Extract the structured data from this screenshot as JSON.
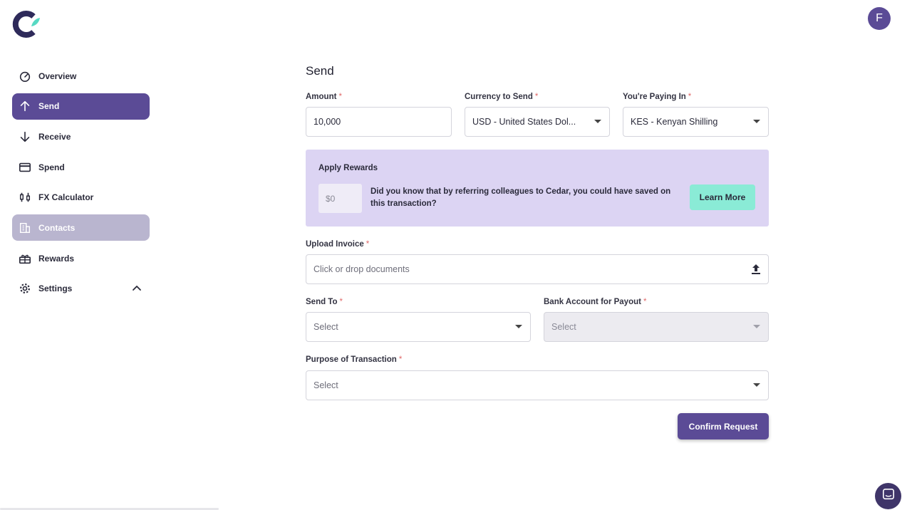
{
  "brand": {
    "avatar_letter": "F",
    "primary_color": "#5b4b96",
    "accent_color": "#57d9c3"
  },
  "nav": {
    "items": [
      {
        "label": "Overview",
        "icon": "gauge-icon"
      },
      {
        "label": "Send",
        "icon": "arrow-up-icon"
      },
      {
        "label": "Receive",
        "icon": "arrow-down-icon"
      },
      {
        "label": "Spend",
        "icon": "credit-card-icon"
      },
      {
        "label": "FX Calculator",
        "icon": "fx-calculator-icon"
      },
      {
        "label": "Contacts",
        "icon": "building-icon"
      },
      {
        "label": "Rewards",
        "icon": "gift-icon"
      },
      {
        "label": "Settings",
        "icon": "gear-icon"
      }
    ]
  },
  "page": {
    "title": "Send"
  },
  "form": {
    "amount": {
      "label": "Amount",
      "value": "10,000"
    },
    "currency_send": {
      "label": "Currency to Send",
      "value": "USD - United States Dol..."
    },
    "paying_in": {
      "label": "You're Paying In",
      "value": "KES - Kenyan Shilling"
    },
    "rewards": {
      "title": "Apply Rewards",
      "amount": "$0",
      "message": "Did you know that by referring colleagues to Cedar, you could have saved on this transaction?",
      "learn_more": "Learn More"
    },
    "upload_invoice": {
      "label": "Upload Invoice",
      "placeholder": "Click or drop documents"
    },
    "send_to": {
      "label": "Send To",
      "value": "Select"
    },
    "bank_account": {
      "label": "Bank Account for Payout",
      "value": "Select"
    },
    "purpose": {
      "label": "Purpose of Transaction",
      "value": "Select"
    },
    "required_marker": "*",
    "confirm": "Confirm Request"
  }
}
